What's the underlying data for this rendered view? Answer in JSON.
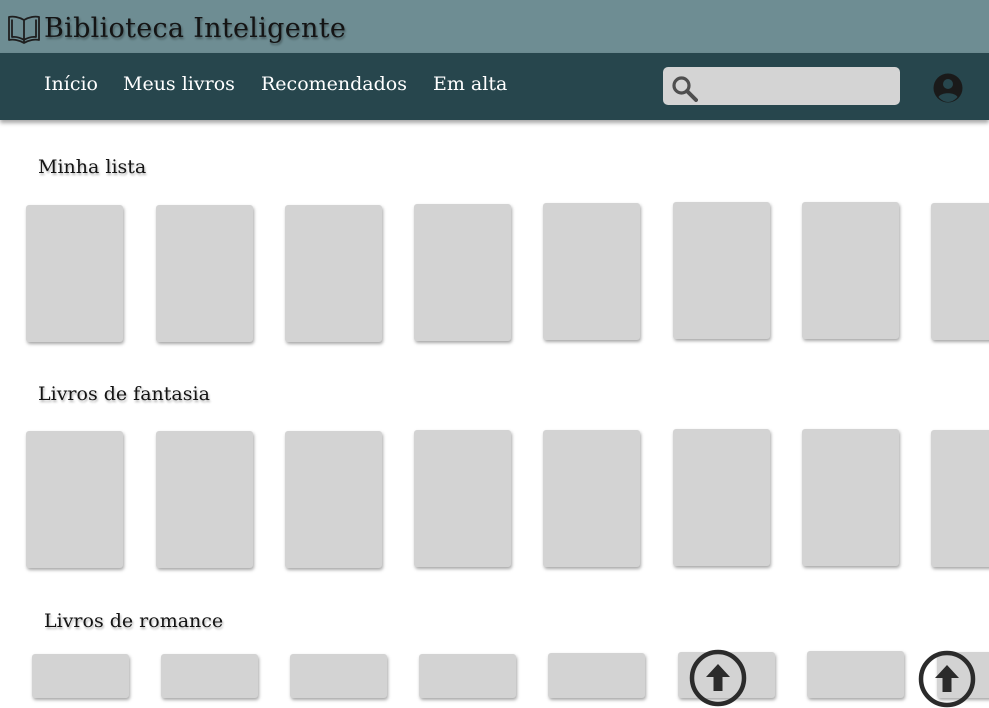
{
  "header": {
    "app_title": "Biblioteca Inteligente"
  },
  "nav": {
    "items": [
      {
        "label": "Início"
      },
      {
        "label": "Meus livros"
      },
      {
        "label": "Recomendados"
      },
      {
        "label": "Em alta"
      }
    ]
  },
  "search": {
    "value": "",
    "placeholder": ""
  },
  "sections": [
    {
      "title": "Minha lista"
    },
    {
      "title": "Livros de fantasia"
    },
    {
      "title": "Livros de romance"
    }
  ],
  "icons": {
    "logo": "open-book-icon",
    "search": "search-icon",
    "account": "account-circle-icon",
    "scroll_up": "arrow-up-circle-icon"
  },
  "colors": {
    "topbar": "#6e8d93",
    "navbar": "#27464d",
    "book_placeholder": "#d3d3d3",
    "search_background": "#d4d4d4"
  }
}
